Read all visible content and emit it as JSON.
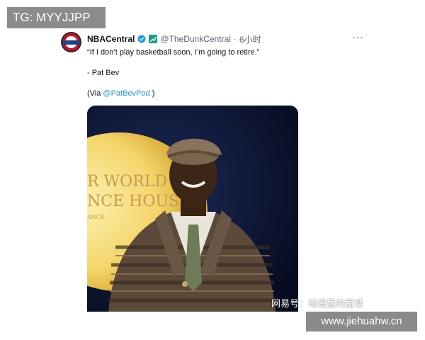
{
  "overlay": {
    "tg_label": "TG: MYYJJPP",
    "watermark_cn": "网易号：动漫里的童话",
    "site_label": "www.jiehuahw.cn"
  },
  "tweet": {
    "display_name": "NBACentral",
    "handle": "@TheDunkCentral",
    "separator": "·",
    "time": "6小时",
    "more_label": "···",
    "quote": "“If I don’t play basketball soon, I’m going to retire.”",
    "attribution": "- Pat Bev",
    "via_prefix": "(Via ",
    "via_mention": "@PatBevPod",
    "via_suffix": " )",
    "media_text": {
      "line1": "R WORLD",
      "line2": "NCE HOUSE",
      "line3": "ANCE"
    }
  },
  "colors": {
    "verified": "#1d9bf0",
    "mention": "#1d9bf0",
    "affiliate": "#16a085",
    "media_background": "#0d1530"
  },
  "icons": {
    "verified": "verified-badge-icon",
    "affiliate": "affiliate-icon",
    "more": "more-icon",
    "avatar": "nba-logo"
  }
}
